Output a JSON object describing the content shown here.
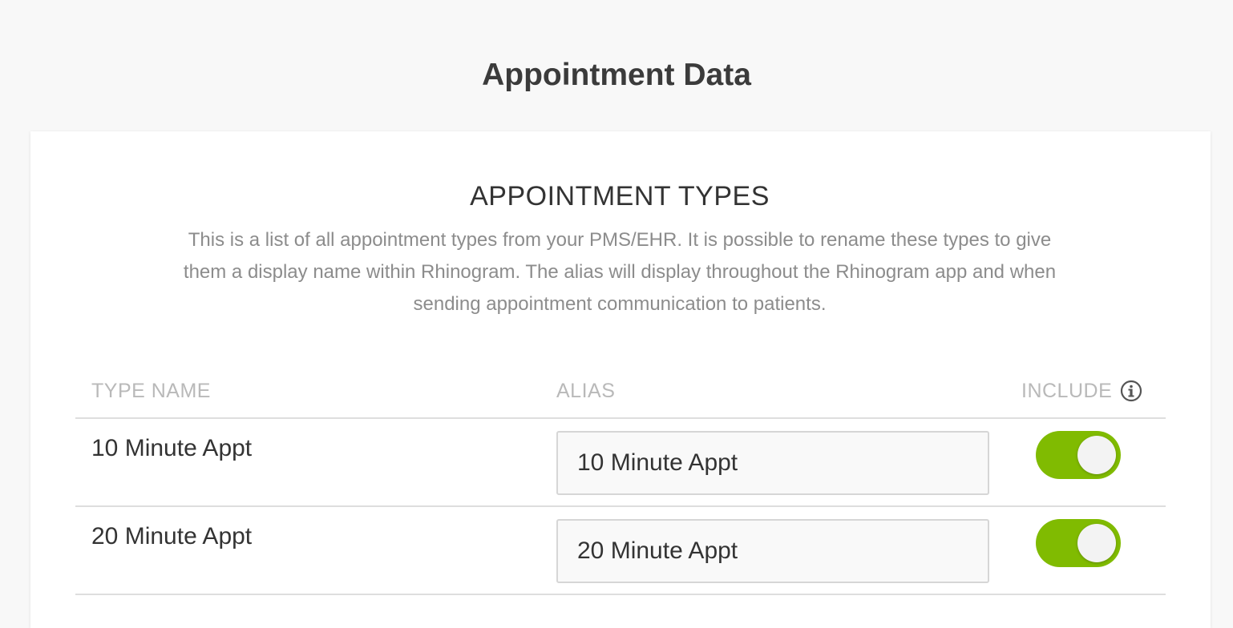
{
  "page": {
    "title": "Appointment Data"
  },
  "section": {
    "title": "APPOINTMENT TYPES",
    "description": "This is a list of all appointment types from your PMS/EHR. It is possible to rename these types to give them a display name within Rhinogram. The alias will display throughout the Rhinogram app and when sending appointment communication to patients."
  },
  "table": {
    "headers": {
      "type_name": "TYPE NAME",
      "alias": "ALIAS",
      "include": "INCLUDE"
    },
    "rows": [
      {
        "type_name": "10 Minute Appt",
        "alias": "10 Minute Appt",
        "include": true
      },
      {
        "type_name": "20 Minute Appt",
        "alias": "20 Minute Appt",
        "include": true
      }
    ]
  },
  "icons": {
    "include_info": "info-circle-icon"
  },
  "colors": {
    "toggle_on": "#80bb01",
    "header_text": "#b9b9b9",
    "description_text": "#8c8c8c"
  }
}
